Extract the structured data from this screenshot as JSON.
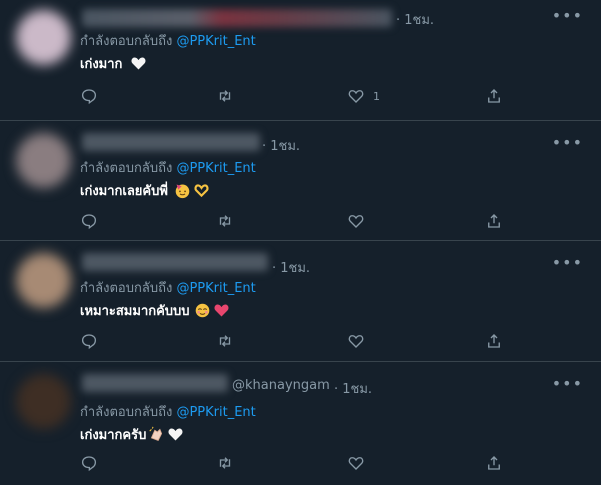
{
  "reply_prefix": "กำลังตอบกลับถึง",
  "more_label": "•••",
  "tweets": [
    {
      "timestamp": "· 1ชม.",
      "reply_handle": "@PPKrit_Ent",
      "text": "เก่งมาก",
      "like_count": "1",
      "avatar_color": "#cbb9c8"
    },
    {
      "timestamp": "· 1ชม.",
      "reply_handle": "@PPKrit_Ent",
      "text": "เก่งมากเลยคับพี่",
      "like_count": "",
      "avatar_color": "#8a7d80"
    },
    {
      "timestamp": "· 1ชม.",
      "reply_handle": "@PPKrit_Ent",
      "text": "เหมาะสมมากคับบบ",
      "like_count": "",
      "avatar_color": "#a78a74"
    },
    {
      "handle": "@khanayngam",
      "timestamp": "· 1ชม.",
      "reply_handle": "@PPKrit_Ent",
      "text": "เก่งมากครับ",
      "like_count": "",
      "avatar_color": "#3e2e24"
    }
  ],
  "icons": [
    "reply-icon",
    "retweet-icon",
    "like-icon",
    "share-icon",
    "more-icon"
  ],
  "colors": {
    "background": "#15202b",
    "secondary_text": "#8899a6",
    "link": "#1d9bf0",
    "divider": "#38444d"
  }
}
